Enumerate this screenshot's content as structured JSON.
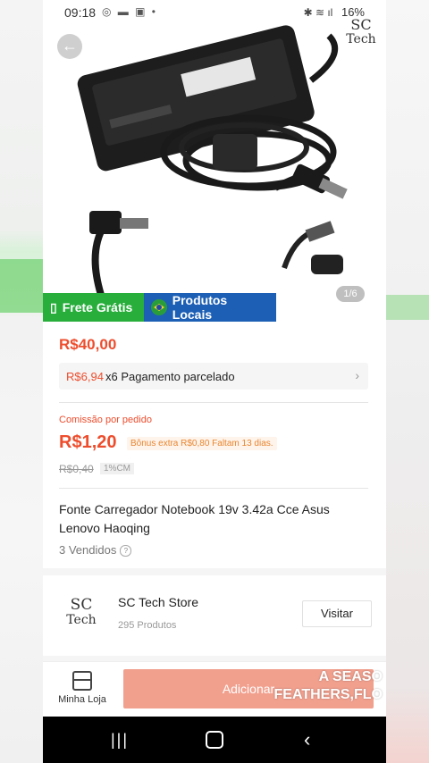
{
  "status_bar": {
    "time": "09:18",
    "battery": "16%"
  },
  "gallery": {
    "logo_sc": "SC",
    "logo_tech": "Tech",
    "image_counter": "1/6",
    "badges": {
      "free_shipping": "Frete Grátis",
      "local_products": "Produtos Locais"
    }
  },
  "product": {
    "price": "R$40,00",
    "installment_amount": "R$6,94",
    "installment_text": "x6 Pagamento parcelado",
    "commission_label": "Comissão por pedido",
    "commission_value": "R$1,20",
    "bonus_text": "Bônus extra R$0,80   Faltam 13 dias.",
    "old_commission": "R$0,40",
    "commission_pct": "1%CM",
    "title": "Fonte Carregador Notebook 19v 3.42a Cce Asus Lenovo Haoqing",
    "sold": "3 Vendidos"
  },
  "store": {
    "logo_sc": "SC",
    "logo_tech": "Tech",
    "name": "SC Tech Store",
    "products": "295 Produtos",
    "visit_label": "Visitar"
  },
  "bottom_bar": {
    "my_shop_label": "Minha Loja",
    "add_label": "Adicionar",
    "overlay_line1": "A SEASO",
    "overlay_line2": "FEATHERS,FLO"
  },
  "colors": {
    "accent": "#ee4d2d",
    "free_badge": "#27ae3b",
    "local_badge": "#1c5fb5"
  }
}
